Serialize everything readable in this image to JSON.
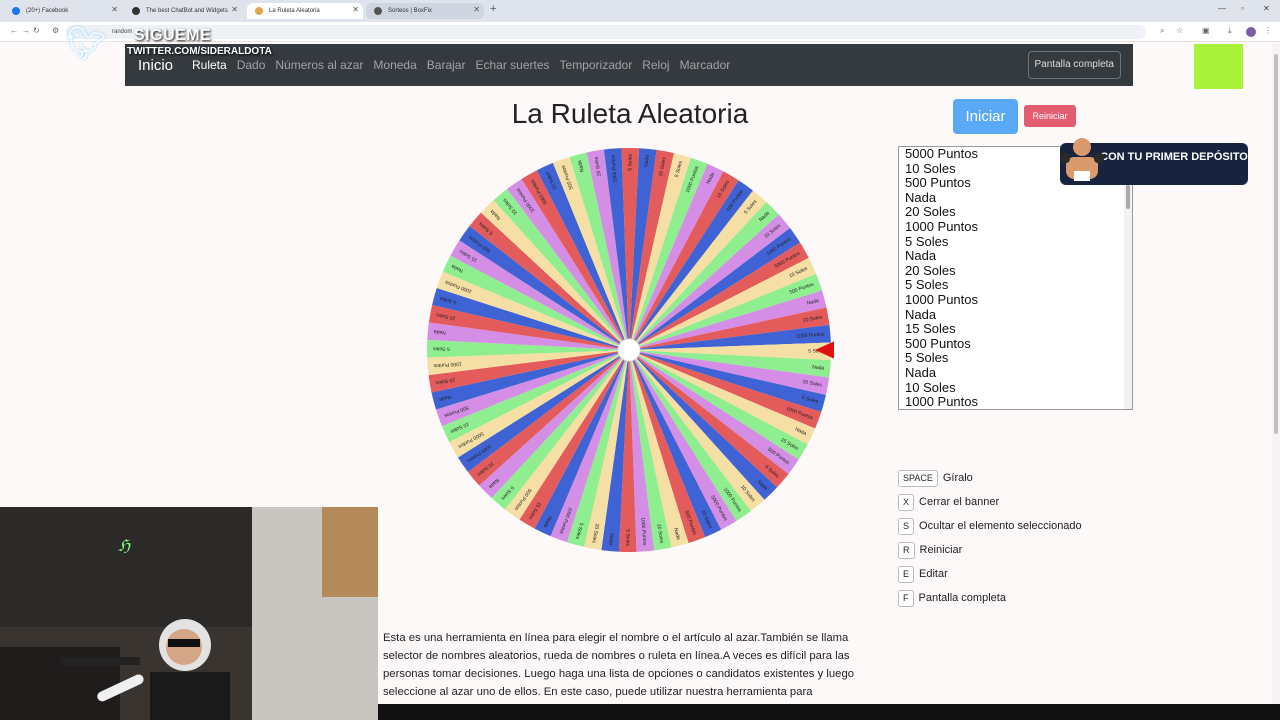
{
  "browser": {
    "tabs": [
      {
        "label": "(20+) Facebook"
      },
      {
        "label": "The best ChatBot and Widgets"
      },
      {
        "label": "La Ruleta Aleatoria"
      },
      {
        "label": "Sorteos | BoxFix"
      }
    ],
    "url": "random"
  },
  "overlay": {
    "follow": "SIGUEME",
    "handle": "TWITTER.COM/SIDERALDOTA"
  },
  "nav": {
    "brand": "Inicio",
    "links": [
      "Ruleta",
      "Dado",
      "Números al azar",
      "Moneda",
      "Barajar",
      "Echar suertes",
      "Temporizador",
      "Reloj",
      "Marcador"
    ],
    "fullscreen": "Pantalla completa"
  },
  "page": {
    "title": "La Ruleta Aleatoria",
    "start_label": "Iniciar",
    "reset_label": "Reiniciar"
  },
  "options": [
    "5000 Puntos",
    "10 Soles",
    "500 Puntos",
    "Nada",
    "20 Soles",
    "1000 Puntos",
    "5 Soles",
    "Nada",
    "20 Soles",
    "5 Soles",
    "1000 Puntos",
    "Nada",
    "15 Soles",
    "500 Puntos",
    "5 Soles",
    "Nada",
    "10 Soles",
    "1000 Puntos"
  ],
  "promo": {
    "text": "CON TU PRIMER DEPÓSITO"
  },
  "shortcuts": [
    {
      "key": "SPACE",
      "label": "Gíralo"
    },
    {
      "key": "X",
      "label": "Cerrar el banner"
    },
    {
      "key": "S",
      "label": "Ocultar el elemento seleccionado"
    },
    {
      "key": "R",
      "label": "Reiniciar"
    },
    {
      "key": "E",
      "label": "Editar"
    },
    {
      "key": "F",
      "label": "Pantalla completa"
    }
  ],
  "description": "Esta es una herramienta en línea para elegir el nombre o el artículo al azar.También se llama selector de nombres aleatorios, rueda de nombres o ruleta en línea.A veces es difícil para las personas tomar decisiones. Luego haga una lista de opciones o candidatos existentes y luego seleccione al azar uno de ellos. En este caso, puede utilizar nuestra herramienta para",
  "wheel": {
    "segment_colors": [
      "#3f63d4",
      "#e35b5b",
      "#f6dfa4",
      "#8fee8f",
      "#d58ee6",
      "#e35b5b",
      "#3f63d4",
      "#f6dfa4",
      "#8fee8f",
      "#d58ee6"
    ],
    "segment_labels": [
      "Nada",
      "20 Soles",
      "5 Soles",
      "1000 Puntos",
      "Nada",
      "15 Soles",
      "500 Puntos",
      "5 Soles",
      "Nada",
      "10 Soles",
      "1000 Puntos",
      "5000 Puntos",
      "10 Soles",
      "500 Puntos",
      "Nada",
      "20 Soles",
      "1000 Puntos",
      "5 Soles",
      "Nada",
      "20 Soles",
      "5 Soles",
      "1000 Puntos",
      "Nada",
      "15 Soles",
      "500 Puntos",
      "5 Soles",
      "Nada",
      "10 Soles",
      "1000 Puntos",
      "5000 Puntos",
      "10 Soles",
      "500 Puntos",
      "Nada",
      "20 Soles",
      "1000 Puntos",
      "5 Soles",
      "Nada",
      "20 Soles",
      "5 Soles",
      "1000 Puntos",
      "Nada",
      "15 Soles",
      "500 Puntos",
      "5 Soles",
      "Nada",
      "10 Soles",
      "1000 Puntos",
      "5000 Puntos",
      "10 Soles",
      "500 Puntos",
      "Nada",
      "20 Soles",
      "1000 Puntos",
      "5 Soles",
      "Nada",
      "20 Soles",
      "5 Soles",
      "1000 Puntos",
      "Nada",
      "15 Soles",
      "500 Puntos",
      "5 Soles",
      "Nada",
      "10 Soles",
      "1000 Puntos",
      "5000 Puntos",
      "10 Soles",
      "500 Puntos",
      "Nada",
      "20 Soles",
      "1000 Puntos",
      "5 Soles"
    ],
    "pointer_color": "#e01010"
  }
}
